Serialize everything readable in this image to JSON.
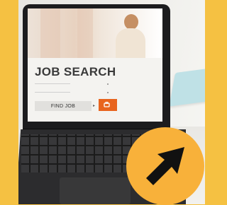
{
  "screen": {
    "heading": "JOB SEARCH",
    "find_button_label": "FIND JOB",
    "search_button_icon": "search-icon"
  },
  "badge": {
    "icon": "cursor-arrow-icon",
    "color": "#f8b13a"
  },
  "colors": {
    "background": "#f5c142",
    "accent": "#e8641e"
  }
}
